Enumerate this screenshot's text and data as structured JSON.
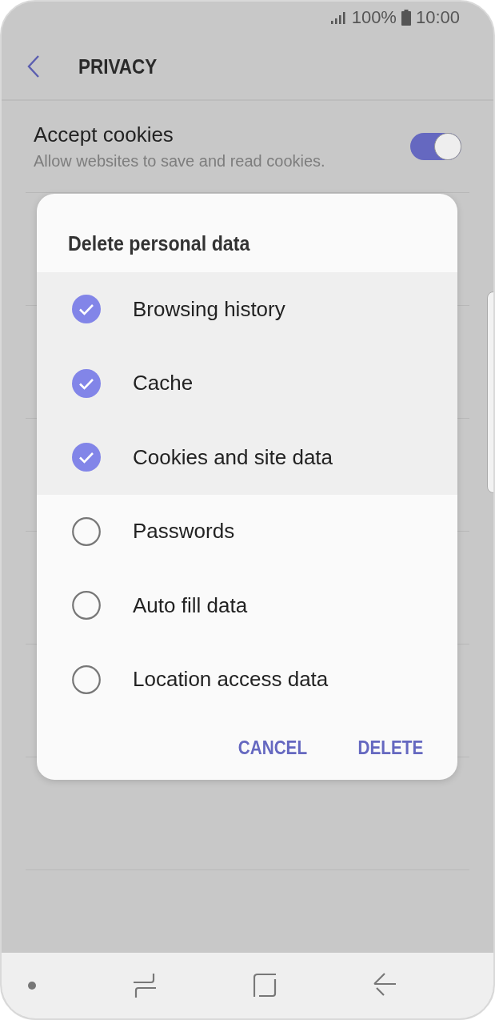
{
  "status_bar": {
    "battery": "100%",
    "time": "10:00"
  },
  "header": {
    "title": "PRIVACY"
  },
  "settings": [
    {
      "title": "Accept cookies",
      "subtitle": "Allow websites to save and read cookies.",
      "on": true
    }
  ],
  "dialog": {
    "title": "Delete personal data",
    "options": [
      {
        "label": "Browsing history",
        "checked": true
      },
      {
        "label": "Cache",
        "checked": true
      },
      {
        "label": "Cookies and site data",
        "checked": true
      },
      {
        "label": "Passwords",
        "checked": false
      },
      {
        "label": "Auto fill data",
        "checked": false
      },
      {
        "label": "Location access data",
        "checked": false
      }
    ],
    "buttons": [
      "CANCEL",
      "DELETE"
    ]
  }
}
